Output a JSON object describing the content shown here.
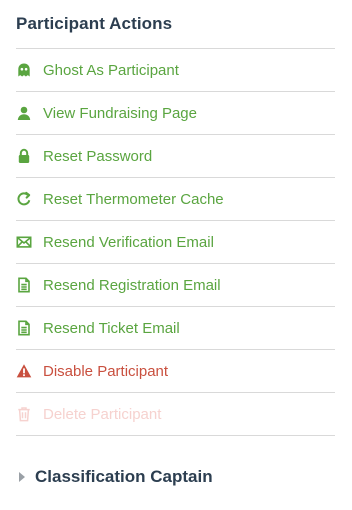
{
  "panel": {
    "title": "Participant Actions"
  },
  "actions": [
    {
      "label": "Ghost As Participant",
      "icon": "ghost-icon",
      "state": "normal"
    },
    {
      "label": "View Fundraising Page",
      "icon": "user-icon",
      "state": "normal"
    },
    {
      "label": "Reset Password",
      "icon": "lock-icon",
      "state": "normal"
    },
    {
      "label": "Reset Thermometer Cache",
      "icon": "refresh-icon",
      "state": "normal"
    },
    {
      "label": "Resend Verification Email",
      "icon": "envelope-icon",
      "state": "normal"
    },
    {
      "label": "Resend Registration Email",
      "icon": "document-icon",
      "state": "normal"
    },
    {
      "label": "Resend Ticket Email",
      "icon": "document-icon",
      "state": "normal"
    },
    {
      "label": "Disable Participant",
      "icon": "warning-icon",
      "state": "danger"
    },
    {
      "label": "Delete Participant",
      "icon": "trash-icon",
      "state": "disabled"
    }
  ],
  "section": {
    "label": "Classification Captain",
    "icon": "caret-right-icon",
    "expanded": false
  },
  "colors": {
    "action_green": "#5aa540",
    "danger_red": "#c9503f",
    "disabled_pink": "#f6d2cf",
    "heading": "#2c3e50",
    "divider": "#d9d9d9"
  }
}
